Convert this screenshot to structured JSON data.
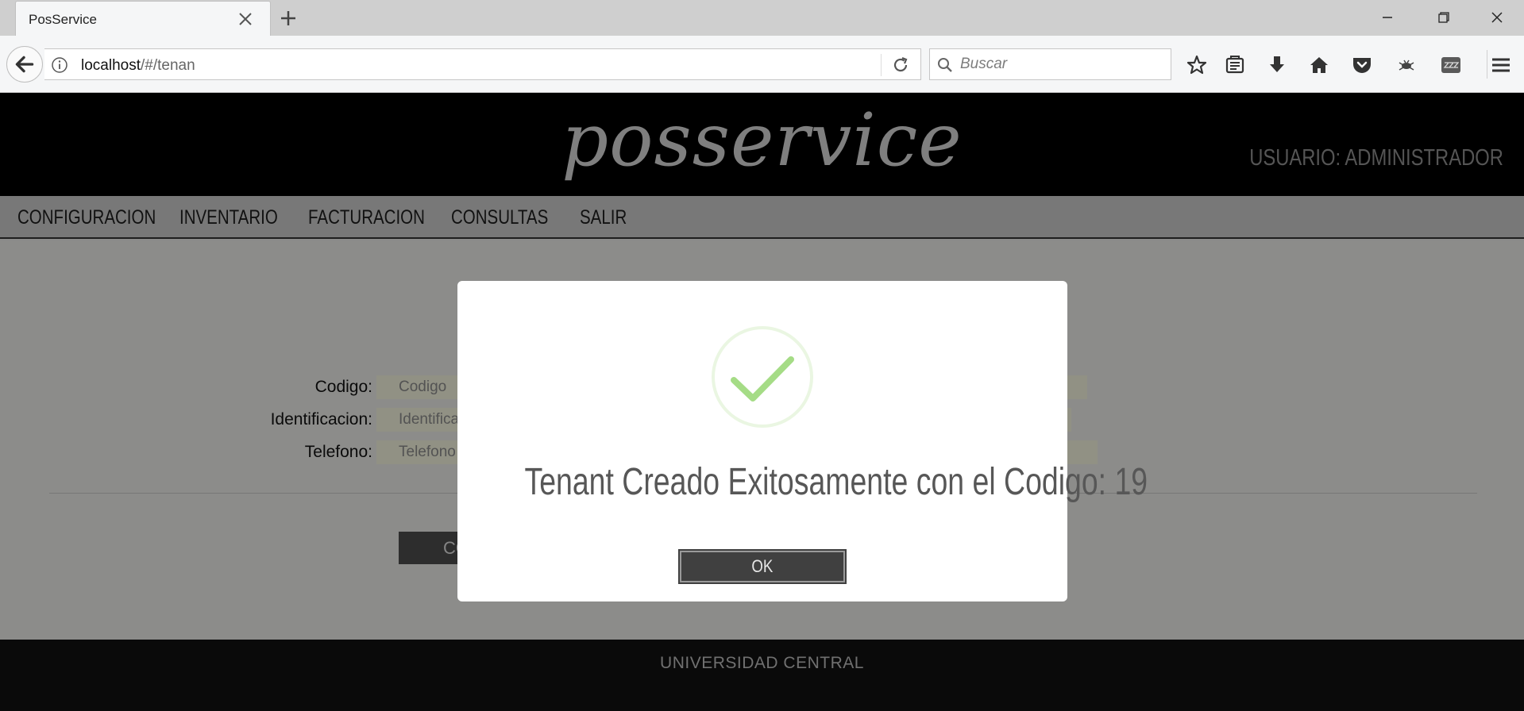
{
  "browser": {
    "tab_title": "PosService",
    "url_host": "localhost",
    "url_path": "/#/tenan",
    "search_placeholder": "Buscar"
  },
  "site": {
    "logo": "posservice",
    "user_label": "USUARIO: ADMINISTRADOR",
    "menu": [
      "CONFIGURACION",
      "INVENTARIO",
      "FACTURACION",
      "CONSULTAS",
      "SALIR"
    ],
    "footer": "UNIVERSIDAD CENTRAL"
  },
  "form": {
    "codigo_label": "Codigo:",
    "codigo_placeholder": "Codigo",
    "identificacion_label": "Identificacion:",
    "identificacion_placeholder": "Identificacion",
    "telefono_label": "Telefono:",
    "telefono_placeholder": "Telefono",
    "save_label": "CO"
  },
  "dialog": {
    "message": "Tenant Creado Exitosamente con el Codigo: 19",
    "ok_label": "OK",
    "icon": "success-check-icon",
    "accent_color": "#a5dc86"
  }
}
